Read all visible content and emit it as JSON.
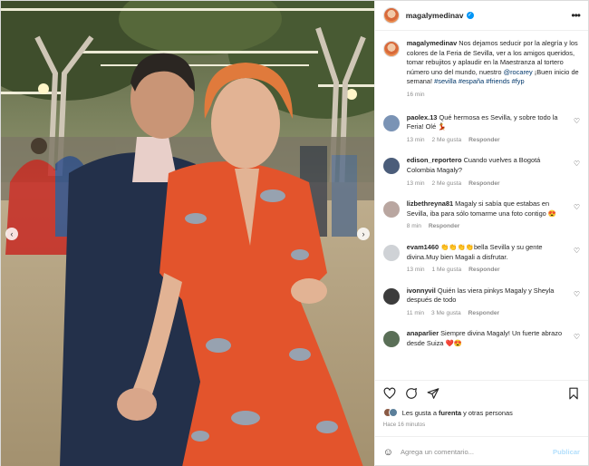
{
  "header": {
    "username": "magalymedinav",
    "verified": true
  },
  "caption": {
    "username": "magalymedinav",
    "text_1": " Nos dejamos seducir por la alegría y los colores de la Feria de Sevilla, ver a los amigos queridos, tomar rebujitos y aplaudir en la Maestranza al tortero número uno del mundo, nuestro ",
    "mention": "@rocarey",
    "text_2": " ¡Buen inicio de semana! ",
    "hashtags": "#sevilla #españa #friends #fyp",
    "time": "16 min"
  },
  "comments": [
    {
      "username": "paolex.13",
      "text": " Qué hermosa es Sevilla, y sobre todo la Feria! Olé 💃",
      "time": "13 min",
      "likes": "2 Me gusta",
      "reply": "Responder",
      "avatar_color": "#7a93b5"
    },
    {
      "username": "edison_reportero",
      "text": " Cuando vuelves a Bogotá Colombia Magaly?",
      "time": "13 min",
      "likes": "2 Me gusta",
      "reply": "Responder",
      "avatar_color": "#4b5d7a"
    },
    {
      "username": "lizbethreyna81",
      "text": " Magaly si sabía que estabas en Sevilla, iba para sólo tomarme una foto contigo 😍",
      "time": "8 min",
      "likes": "",
      "reply": "Responder",
      "avatar_color": "#b9a6a0"
    },
    {
      "username": "evam1460",
      "text": " 👏👏👏👏bella Sevilla y su gente divina.Muy bien Magali a disfrutar.",
      "time": "13 min",
      "likes": "1 Me gusta",
      "reply": "Responder",
      "avatar_color": "#cfd2d6"
    },
    {
      "username": "ivonnyvil",
      "text": " Quién las viera pinkys Magaly y Sheyla después de todo",
      "time": "11 min",
      "likes": "3 Me gusta",
      "reply": "Responder",
      "avatar_color": "#3c3c3c"
    },
    {
      "username": "anaparlier",
      "text": " Siempre divina Magaly! Un fuerte abrazo desde Suiza ❤️😍",
      "time": "",
      "likes": "",
      "reply": "",
      "avatar_color": "#5a6f57"
    }
  ],
  "likes_text_1": "Les gusta a ",
  "likes_user": "furenta",
  "likes_text_2": " y otras personas",
  "time_ago": "Hace 16 minutos",
  "add_comment_placeholder": "Agrega un comentario...",
  "publish_label": "Publicar",
  "icons": [
    "heart-icon",
    "comment-icon",
    "share-icon",
    "bookmark-icon",
    "emoji-icon",
    "more-icon",
    "verified-icon"
  ]
}
